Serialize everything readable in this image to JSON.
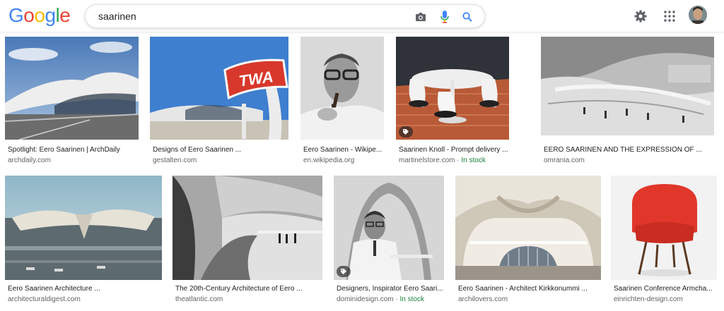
{
  "logo": {
    "letters": [
      "G",
      "o",
      "o",
      "g",
      "l",
      "e"
    ],
    "colors": [
      "#4285F4",
      "#EA4335",
      "#FBBC05",
      "#4285F4",
      "#34A853",
      "#EA4335"
    ]
  },
  "search": {
    "query": "saarinen"
  },
  "results": [
    {
      "title": "Spotlight: Eero Saarinen | ArchDaily",
      "domain": "archdaily.com",
      "stock": ""
    },
    {
      "title": "Designs of Eero Saarinen ...",
      "domain": "gestalten.com",
      "stock": ""
    },
    {
      "title": "Eero Saarinen - Wikipe...",
      "domain": "en.wikipedia.org",
      "stock": ""
    },
    {
      "title": "Saarinen Knoll - Prompt delivery ...",
      "domain": "martinelstore.com",
      "stock": "In stock"
    },
    {
      "title": "EERO SAARINEN AND THE EXPRESSION OF ...",
      "domain": "omrania.com",
      "stock": ""
    },
    {
      "title": "Eero Saarinen Architecture ...",
      "domain": "architecturaldigest.com",
      "stock": ""
    },
    {
      "title": "The 20th-Century Architecture of Eero ...",
      "domain": "theatlantic.com",
      "stock": ""
    },
    {
      "title": "Designers, Inspirator Eero Saari...",
      "domain": "dominidesign.com",
      "stock": "In stock"
    },
    {
      "title": "Eero Saarinen - Architect Kirkkonummi ...",
      "domain": "archilovers.com",
      "stock": ""
    },
    {
      "title": "Saarinen Conference Armcha...",
      "domain": "einrichten-design.com",
      "stock": ""
    }
  ],
  "separator": "·",
  "sign_text": "TWA",
  "icons": {
    "camera": "camera-icon",
    "mic": "microphone-icon",
    "search": "search-icon",
    "settings": "gear-icon",
    "apps": "apps-grid-icon",
    "tag": "price-tag-icon"
  }
}
